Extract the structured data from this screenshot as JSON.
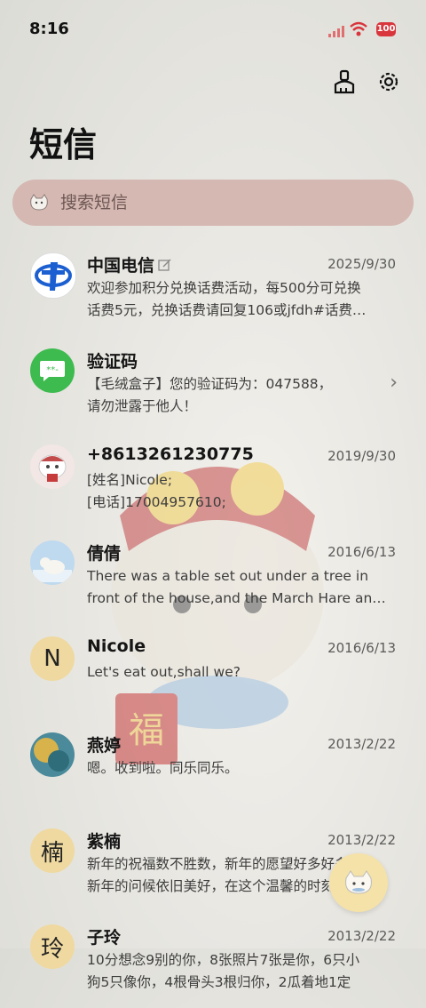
{
  "status": {
    "time": "8:16",
    "battery": "100"
  },
  "title": "短信",
  "search": {
    "placeholder": "搜索短信"
  },
  "conversations": [
    {
      "name": "中国电信",
      "date": "2025/9/30",
      "lines": [
        "欢迎参加积分兑换话费活动，每500分可兑换",
        "话费5元，兑换话费请回复106或jfdh#话费…"
      ]
    },
    {
      "name": "验证码",
      "date": "",
      "lines": [
        "【毛绒盒子】您的验证码为：047588，",
        "请勿泄露于他人！"
      ]
    },
    {
      "name": "+8613261230775",
      "date": "2019/9/30",
      "lines": [
        "[姓名]Nicole;",
        "[电话]17004957610;"
      ]
    },
    {
      "name": "倩倩",
      "date": "2016/6/13",
      "lines": [
        "There was a table set out under a tree in",
        "front of the house,and the March Hare an…"
      ]
    },
    {
      "name": "Nicole",
      "date": "2016/6/13",
      "avatar_letter": "N",
      "lines": [
        "Let's eat out,shall we?"
      ]
    },
    {
      "name": "燕婷",
      "date": "2013/2/22",
      "lines": [
        "嗯。收到啦。同乐同乐。"
      ]
    },
    {
      "name": "紫楠",
      "date": "2013/2/22",
      "avatar_letter": "楠",
      "lines": [
        "新年的祝福数不胜数，新年的愿望好多好多，",
        "新年的问候依旧美好，在这个温馨的时刻…"
      ]
    },
    {
      "name": "子玲",
      "date": "2013/2/22",
      "avatar_letter": "玲",
      "lines": [
        "10分想念9别的你，8张照片7张是你，6只小",
        "狗5只像你，4根骨头3根归你，2瓜着地1定"
      ]
    }
  ],
  "colors": {
    "search_bg": "#d5b8b2",
    "accent_green": "#3dbb4f",
    "telecom_blue": "#1b5fd0",
    "letter_avatar": "#efd9a0"
  }
}
